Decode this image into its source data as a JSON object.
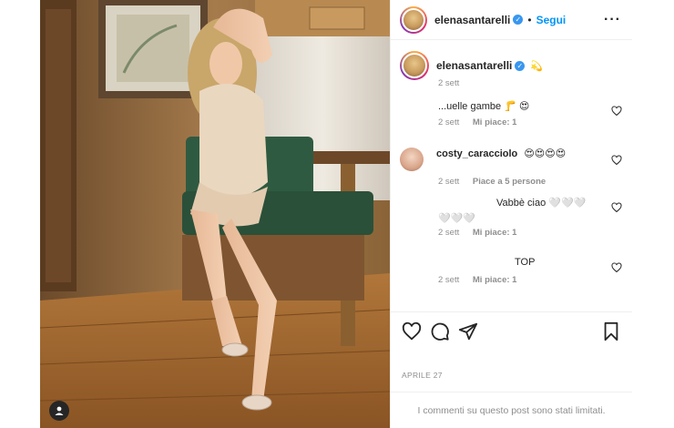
{
  "post": {
    "username": "elenasantarelli",
    "follow_label": "Segui",
    "more_label": "···",
    "caption": {
      "username": "elenasantarelli",
      "emoji": "💫",
      "time": "2 sett"
    },
    "comments": [
      {
        "username": "",
        "text": "...uelle gambe 🦵 😍",
        "time": "2 sett",
        "likes": "Mi piace: 1"
      },
      {
        "username": "costy_caracciolo",
        "text": "😍😍😍😍",
        "time": "2 sett",
        "likes": "Piace a 5 persone"
      },
      {
        "username": "",
        "text": "Vabbè ciao 🤍🤍🤍",
        "text2": "🤍🤍🤍",
        "time": "2 sett",
        "likes": "Mi piace: 1"
      },
      {
        "username": "",
        "text": "TOP",
        "time": "2 sett",
        "likes": "Mi piace: 1"
      }
    ],
    "date": "APRILE 27",
    "limited_notice": "I commenti su questo post sono stati limitati."
  },
  "colors": {
    "accent": "#0095f6",
    "verified": "#3897f0",
    "muted": "#8e8e8e"
  }
}
